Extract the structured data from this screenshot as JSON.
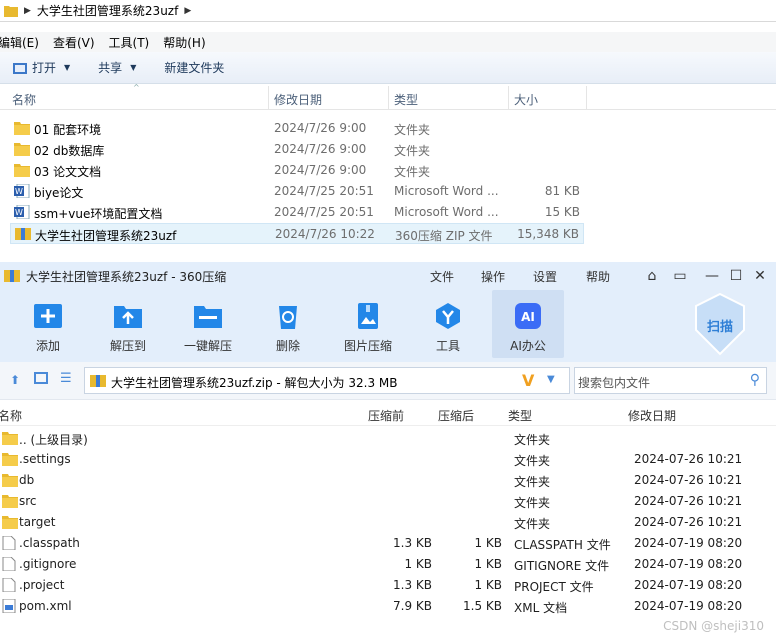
{
  "explorer": {
    "address_path": "大学生社团管理系统23uzf",
    "menu": [
      "编辑(E)",
      "查看(V)",
      "工具(T)",
      "帮助(H)"
    ],
    "toolbar": {
      "open": "打开",
      "share": "共享",
      "new_folder": "新建文件夹"
    },
    "columns": {
      "name": "名称",
      "date": "修改日期",
      "type": "类型",
      "size": "大小"
    },
    "files": [
      {
        "name": "01 配套环境",
        "date": "2024/7/26 9:00",
        "type": "文件夹",
        "size": "",
        "icon": "folder-icon"
      },
      {
        "name": "02 db数据库",
        "date": "2024/7/26 9:00",
        "type": "文件夹",
        "size": "",
        "icon": "folder-icon"
      },
      {
        "name": "03 论文文档",
        "date": "2024/7/26 9:00",
        "type": "文件夹",
        "size": "",
        "icon": "folder-icon"
      },
      {
        "name": "biye论文",
        "date": "2024/7/25 20:51",
        "type": "Microsoft Word ...",
        "size": "81 KB",
        "icon": "word-icon"
      },
      {
        "name": "ssm+vue环境配置文档",
        "date": "2024/7/25 20:51",
        "type": "Microsoft Word ...",
        "size": "15 KB",
        "icon": "word-icon"
      },
      {
        "name": "大学生社团管理系统23uzf",
        "date": "2024/7/26 10:22",
        "type": "360压缩 ZIP 文件",
        "size": "15,348 KB",
        "icon": "zip-icon"
      }
    ]
  },
  "zip": {
    "title": "大学生社团管理系统23uzf - 360压缩",
    "menu": [
      "文件",
      "操作",
      "设置",
      "帮助"
    ],
    "ribbon": [
      "添加",
      "解压到",
      "一键解压",
      "删除",
      "图片压缩",
      "工具",
      "AI办公"
    ],
    "scan_label": "扫描",
    "path_text": "大学生社团管理系统23uzf.zip - 解包大小为 32.3 MB",
    "search_placeholder": "搜索包内文件",
    "columns": {
      "name": "名称",
      "before": "压缩前",
      "after": "压缩后",
      "type": "类型",
      "modified": "修改日期"
    },
    "rows": [
      {
        "name": ".. (上级目录)",
        "before": "",
        "after": "",
        "type": "文件夹",
        "modified": "",
        "icon": "folder-icon"
      },
      {
        "name": ".settings",
        "before": "",
        "after": "",
        "type": "文件夹",
        "modified": "2024-07-26 10:21",
        "icon": "folder-icon"
      },
      {
        "name": "db",
        "before": "",
        "after": "",
        "type": "文件夹",
        "modified": "2024-07-26 10:21",
        "icon": "folder-icon"
      },
      {
        "name": "src",
        "before": "",
        "after": "",
        "type": "文件夹",
        "modified": "2024-07-26 10:21",
        "icon": "folder-icon"
      },
      {
        "name": "target",
        "before": "",
        "after": "",
        "type": "文件夹",
        "modified": "2024-07-26 10:21",
        "icon": "folder-icon"
      },
      {
        "name": ".classpath",
        "before": "1.3 KB",
        "after": "1 KB",
        "type": "CLASSPATH 文件",
        "modified": "2024-07-19 08:20",
        "icon": "file-icon"
      },
      {
        "name": ".gitignore",
        "before": "1 KB",
        "after": "1 KB",
        "type": "GITIGNORE 文件",
        "modified": "2024-07-19 08:20",
        "icon": "file-icon"
      },
      {
        "name": ".project",
        "before": "1.3 KB",
        "after": "1 KB",
        "type": "PROJECT 文件",
        "modified": "2024-07-19 08:20",
        "icon": "file-icon"
      },
      {
        "name": "pom.xml",
        "before": "7.9 KB",
        "after": "1.5 KB",
        "type": "XML 文档",
        "modified": "2024-07-19 08:20",
        "icon": "xml-file-icon"
      }
    ]
  },
  "watermark": "CSDN @sheji310",
  "colors": {
    "folder": "#e8b92f",
    "accent": "#1a88e0",
    "ribbon_bg": "#e3eefb"
  }
}
